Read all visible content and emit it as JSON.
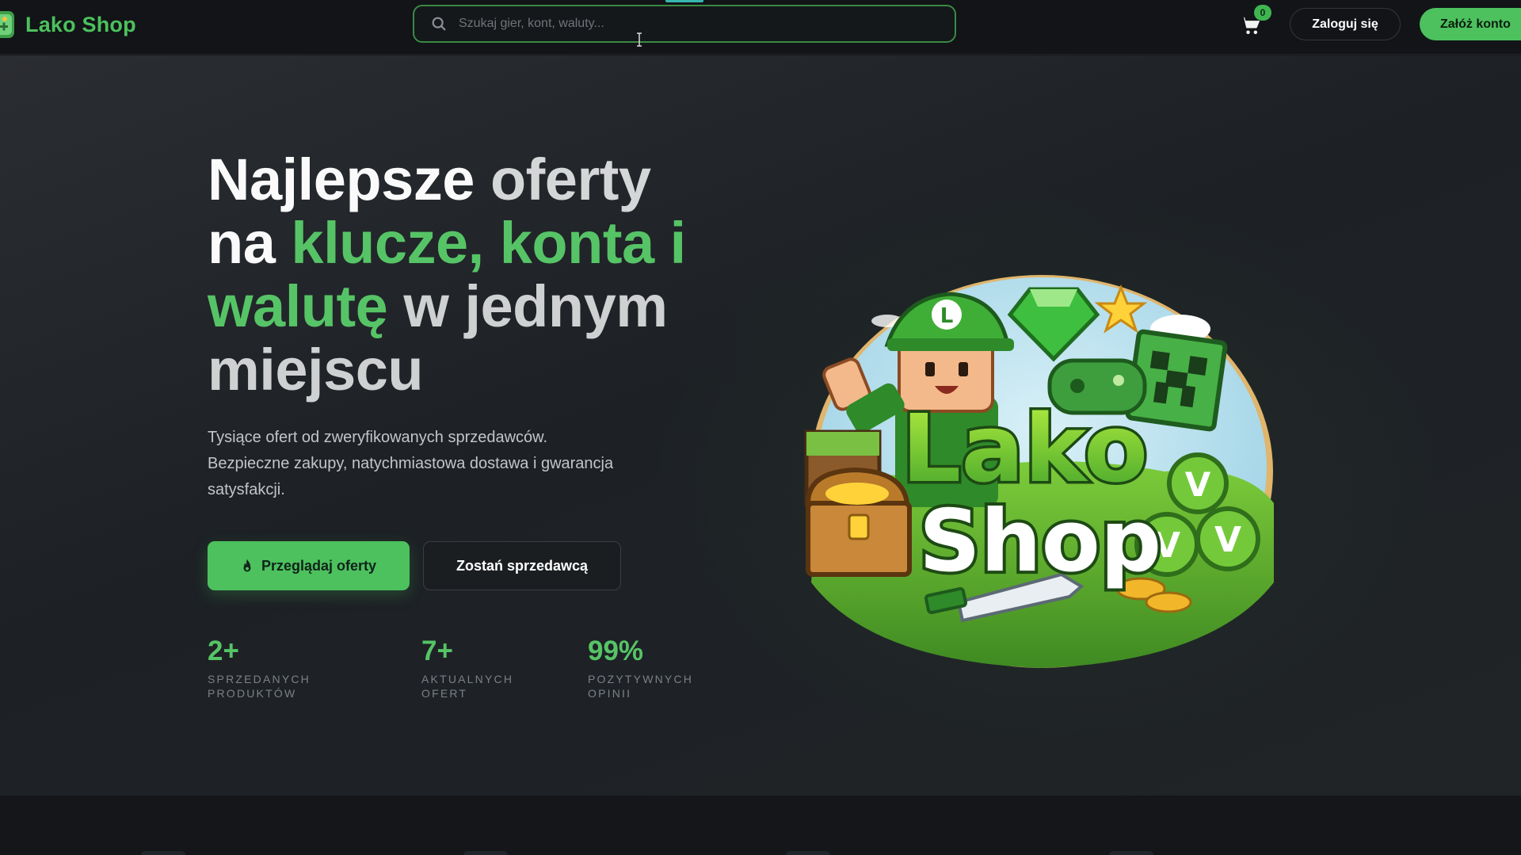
{
  "header": {
    "brand": "Lako Shop",
    "search_placeholder": "Szukaj gier, kont, waluty...",
    "cart_count": "0",
    "login_label": "Zaloguj się",
    "register_label": "Załóż konto"
  },
  "hero": {
    "title_parts": [
      "Najlepsze",
      " oferty",
      "na ",
      "klucze, konta i",
      "walutę",
      " w jednym",
      "miejscu"
    ],
    "description_lines": [
      "Tysiące ofert od zweryfikowanych sprzedawców.",
      "Bezpieczne zakupy, natychmiastowa dostawa i gwarancja",
      "satysfakcji."
    ],
    "primary_button": "Przeglądaj oferty",
    "secondary_button": "Zostań sprzedawcą",
    "stats": [
      {
        "value": "2+",
        "label_lines": [
          "Sprzedanych",
          "produktów"
        ]
      },
      {
        "value": "7+",
        "label_lines": [
          "Aktualnych",
          "ofert"
        ]
      },
      {
        "value": "99%",
        "label_lines": [
          "Pozytywnych",
          "opinii"
        ]
      }
    ],
    "art": {
      "line1": "Lako",
      "line2": "Shop",
      "cap_letter": "L",
      "coin_letter": "V"
    }
  },
  "colors": {
    "accent": "#4cc15d",
    "background": "#1d2125",
    "header": "#121417"
  },
  "icons": {
    "logo": "gamepad-logo-icon",
    "search": "search-icon",
    "cart": "cart-icon",
    "primary_button": "fire-icon"
  }
}
